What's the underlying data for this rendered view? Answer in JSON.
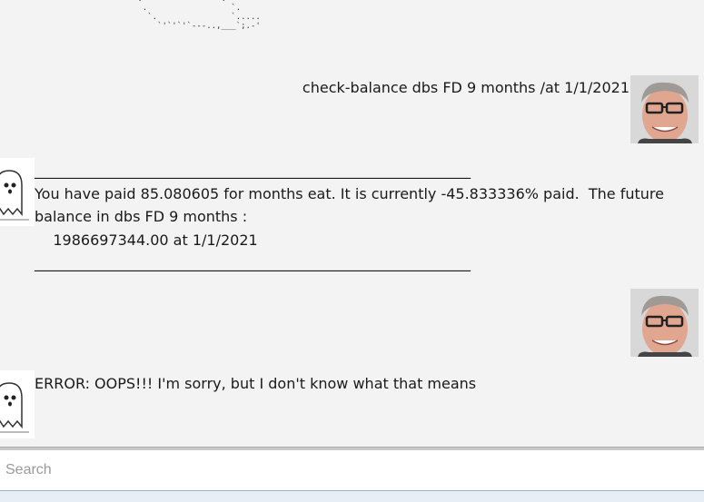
{
  "chat": {
    "ascii_art": "        :                .\n         .                 `.\n          `.               `.....\n            `'`'`'`---..,___`;.-'",
    "messages": [
      {
        "sender": "user",
        "text": "check-balance dbs FD 9 months /at 1/1/2021",
        "avatar_icon": "user-avatar-photo"
      },
      {
        "sender": "bot",
        "text": "____________________________________________________________\nYou have paid 85.080605 for months eat. It is currently -45.833336% paid.  The future\nbalance in dbs FD 9 months :\n    1986697344.00 at 1/1/2021\n____________________________________________________________",
        "avatar_icon": "ghost-avatar"
      },
      {
        "sender": "user",
        "text": "",
        "avatar_icon": "user-avatar-photo"
      },
      {
        "sender": "bot",
        "text": "ERROR: OOPS!!! I'm sorry, but I don't know what that means",
        "avatar_icon": "ghost-avatar"
      }
    ]
  },
  "input": {
    "placeholder": "Search",
    "value": ""
  }
}
